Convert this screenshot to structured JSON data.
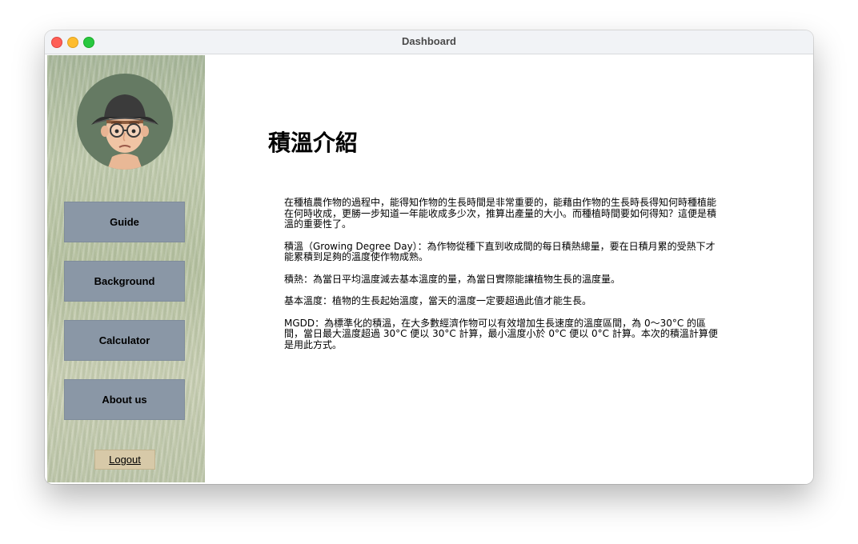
{
  "window": {
    "title": "Dashboard"
  },
  "sidebar": {
    "nav": [
      {
        "label": "Guide"
      },
      {
        "label": "Background"
      },
      {
        "label": "Calculator"
      },
      {
        "label": "About us"
      }
    ],
    "logout_label": "Logout"
  },
  "main": {
    "heading": "積溫介紹",
    "paragraphs": [
      "在種植農作物的過程中，能得知作物的生長時間是非常重要的，能藉由作物的生長時長得知何時種植能在何時收成，更勝一步知道一年能收成多少次，推算出產量的大小。而種植時間要如何得知？這便是積溫的重要性了。",
      "積溫（Growing Degree Day）：為作物從種下直到收成間的每日積熱總量，要在日積月累的受熱下才能累積到足夠的溫度使作物成熟。",
      "積熱：為當日平均溫度減去基本溫度的量，為當日實際能讓植物生長的溫度量。",
      "基本溫度：植物的生長起始溫度，當天的溫度一定要超過此值才能生長。",
      "MGDD：為標準化的積溫，在大多數經濟作物可以有效增加生長速度的溫度區間，為 0～30°C 的區間，當日最大溫度超過 30°C 便以 30°C 計算，最小溫度小於 0°C 便以 0°C 計算。本次的積溫計算便是用此方式。"
    ]
  },
  "colors": {
    "nav_button": "#8a97a6",
    "logout_button": "#d7c9a8",
    "avatar_bg": "#657a63"
  }
}
